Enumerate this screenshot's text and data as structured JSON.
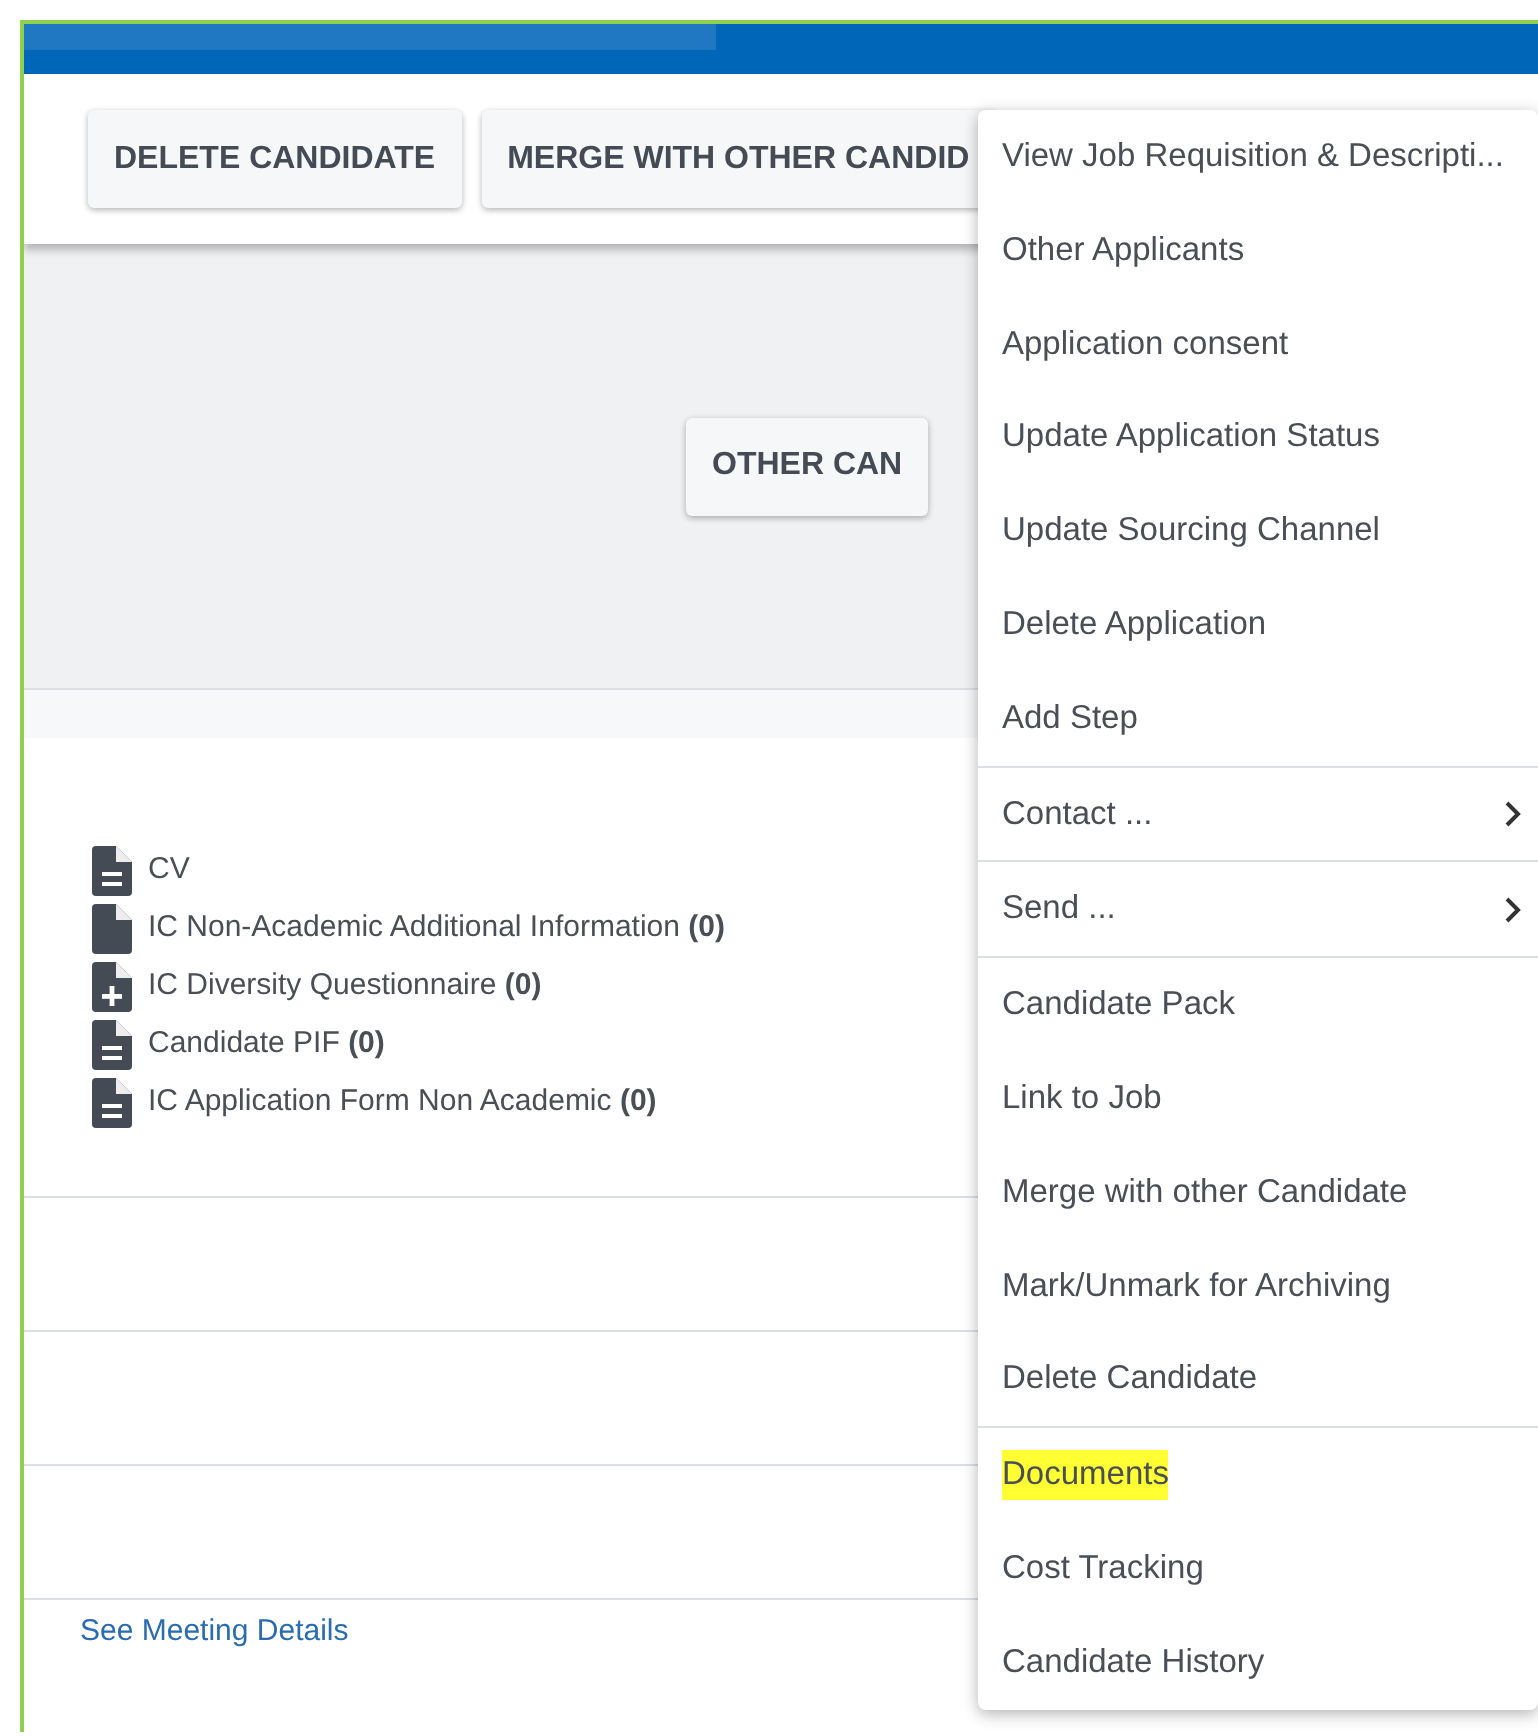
{
  "toolbar": {
    "buttons": [
      {
        "label": "DELETE CANDIDATE"
      },
      {
        "label": "MERGE WITH OTHER CANDID"
      }
    ]
  },
  "panel": {
    "button": {
      "label": "OTHER CAN"
    }
  },
  "documents": [
    {
      "kind": "lines",
      "title": "CV"
    },
    {
      "kind": "blank",
      "title": "IC Non-Academic Additional Information",
      "count": "(0)"
    },
    {
      "kind": "plus",
      "title": "IC Diversity Questionnaire",
      "count": "(0)"
    },
    {
      "kind": "lines",
      "title": "Candidate PIF",
      "count": "(0)"
    },
    {
      "kind": "lines",
      "title": "IC Application Form Non Academic",
      "count": "(0)"
    }
  ],
  "link": "See Meeting Details",
  "menu": {
    "groups": [
      {
        "items": [
          {
            "label": "View Job Requisition & Descripti...",
            "submenu": false,
            "highlighted": false
          },
          {
            "label": "Other Applicants",
            "submenu": false,
            "highlighted": false
          },
          {
            "label": "Application consent",
            "submenu": false,
            "highlighted": false
          },
          {
            "label": "Update Application Status",
            "submenu": false,
            "highlighted": false
          },
          {
            "label": "Update Sourcing Channel",
            "submenu": false,
            "highlighted": false
          },
          {
            "label": "Delete Application",
            "submenu": false,
            "highlighted": false
          },
          {
            "label": "Add Step",
            "submenu": false,
            "highlighted": false
          }
        ]
      },
      {
        "items": [
          {
            "label": "Contact ...",
            "submenu": true,
            "highlighted": false
          }
        ]
      },
      {
        "items": [
          {
            "label": "Send ...",
            "submenu": true,
            "highlighted": false
          }
        ]
      },
      {
        "items": [
          {
            "label": "Candidate Pack",
            "submenu": false,
            "highlighted": false
          },
          {
            "label": "Link to Job",
            "submenu": false,
            "highlighted": false
          },
          {
            "label": "Merge with other Candidate",
            "submenu": false,
            "highlighted": false
          },
          {
            "label": "Mark/Unmark for Archiving",
            "submenu": false,
            "highlighted": false
          },
          {
            "label": "Delete Candidate",
            "submenu": false,
            "highlighted": false
          }
        ]
      },
      {
        "items": [
          {
            "label": "Documents",
            "submenu": false,
            "highlighted": true
          },
          {
            "label": "Cost Tracking",
            "submenu": false,
            "highlighted": false
          },
          {
            "label": "Candidate History",
            "submenu": false,
            "highlighted": false
          }
        ]
      }
    ]
  }
}
